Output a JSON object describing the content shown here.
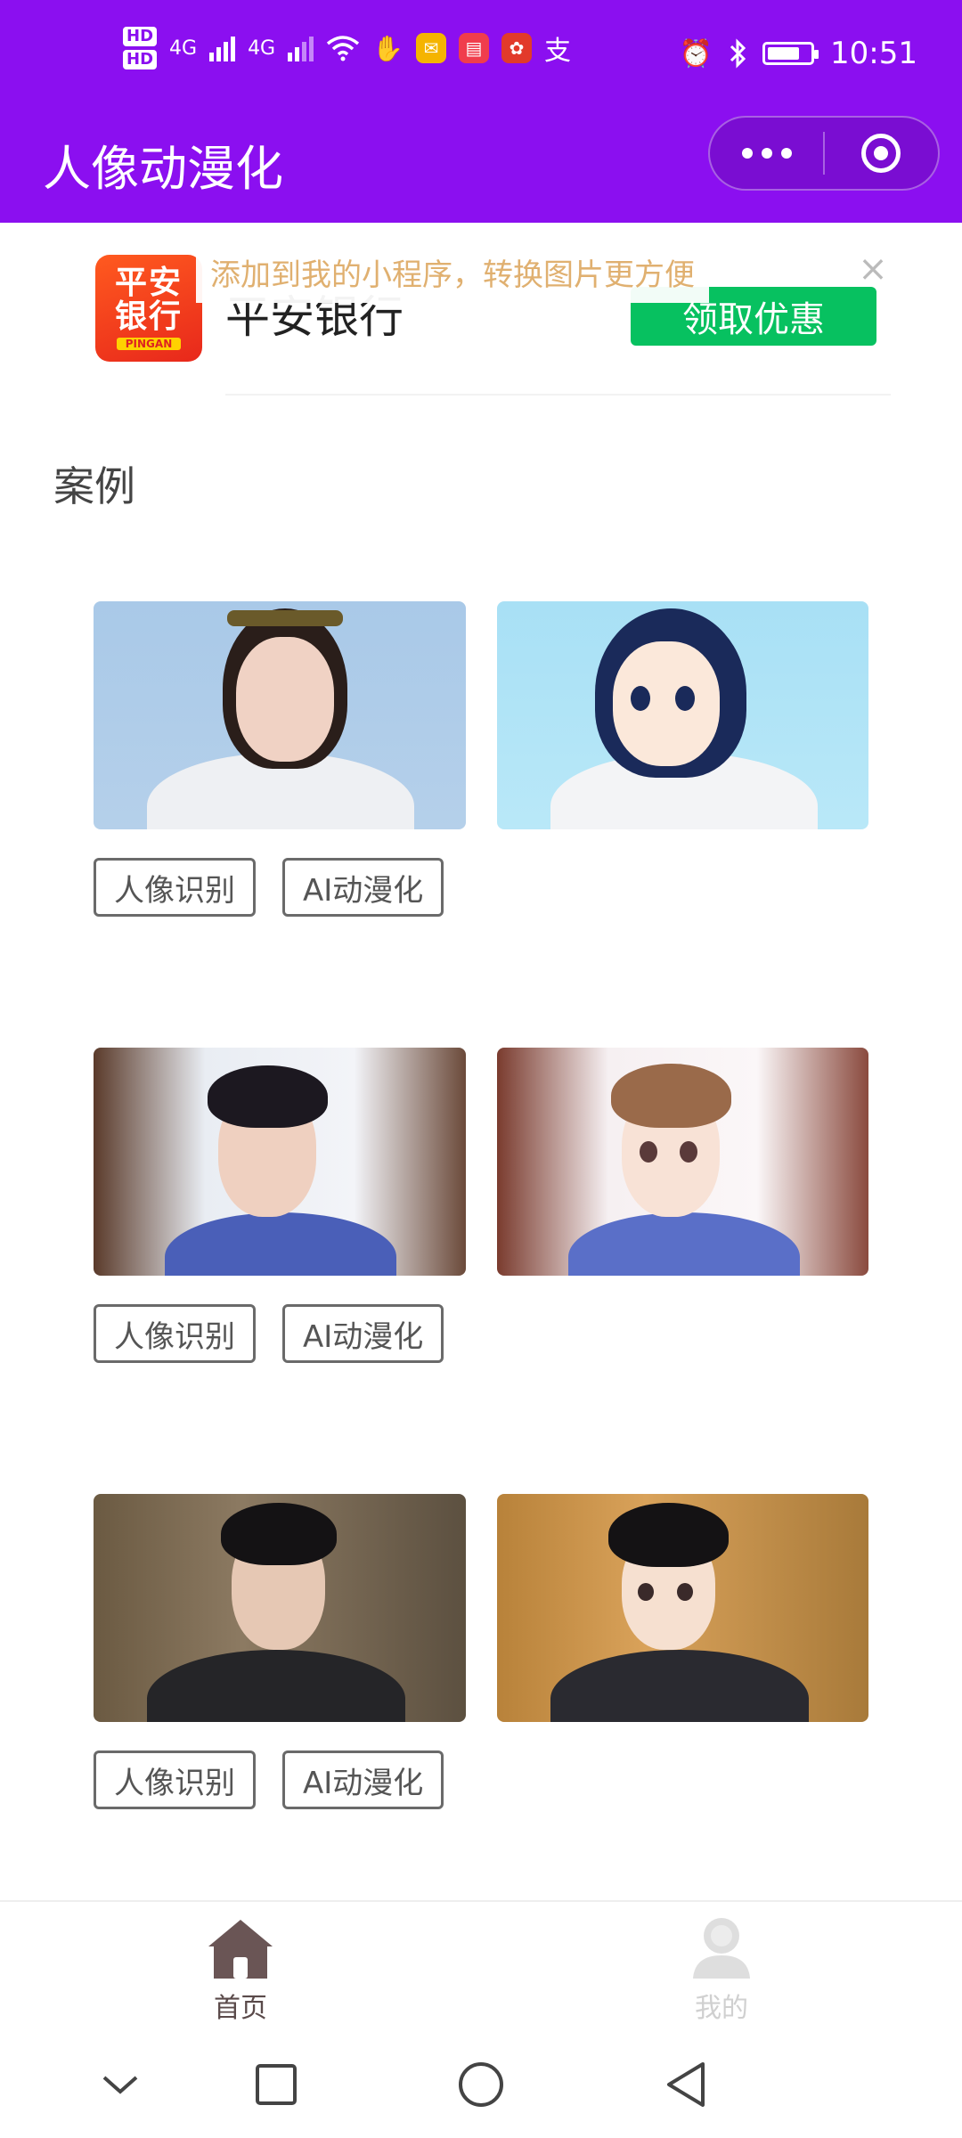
{
  "status_bar": {
    "hd1": "HD",
    "hd2": "HD",
    "net1": "4G",
    "net2": "4G",
    "time": "10:51",
    "icons": [
      "signal-icon",
      "wifi-icon",
      "hand-icon",
      "mail-app-icon",
      "book-app-icon",
      "flower-app-icon",
      "alipay-icon",
      "alarm-icon",
      "bluetooth-icon",
      "battery-icon"
    ],
    "battery_level": 0.75
  },
  "header": {
    "title": "人像动漫化",
    "accent_color": "#8b0ff0"
  },
  "ad": {
    "logo_line1": "平安",
    "logo_line2": "银行",
    "logo_sub": "PINGAN",
    "name": "平安银行",
    "button": "领取优惠",
    "tip": "添加到我的小程序，转换图片更方便",
    "close": "×"
  },
  "section": {
    "title": "案例"
  },
  "examples": [
    {
      "tags": [
        "人像识别",
        "AI动漫化"
      ]
    },
    {
      "tags": [
        "人像识别",
        "AI动漫化"
      ]
    },
    {
      "tags": [
        "人像识别",
        "AI动漫化"
      ]
    }
  ],
  "tabbar": {
    "items": [
      {
        "label": "首页",
        "icon": "home-icon",
        "active": true
      },
      {
        "label": "我的",
        "icon": "user-icon",
        "active": false
      }
    ]
  },
  "nav": {
    "icons": [
      "chevron-down-icon",
      "recents-icon",
      "home-circle-icon",
      "back-icon"
    ]
  }
}
